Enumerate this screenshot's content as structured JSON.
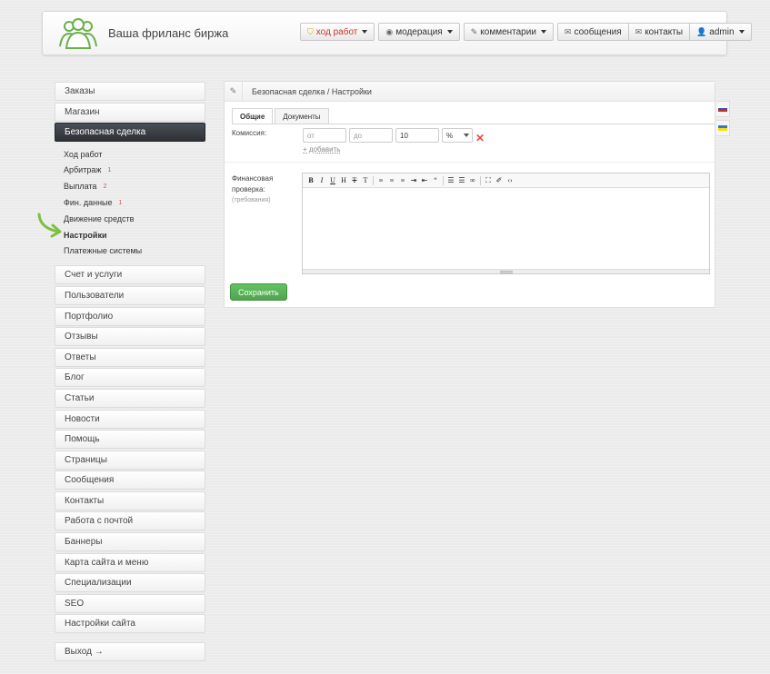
{
  "header": {
    "site_title": "Ваша фриланс биржа",
    "nav": [
      {
        "label": "ход работ",
        "icon": "shield-icon",
        "dropdown": true,
        "active": true
      },
      {
        "label": "модерация",
        "icon": "eye-icon",
        "dropdown": true
      },
      {
        "label": "комментарии",
        "icon": "pencil-icon",
        "dropdown": true
      },
      {
        "label": "сообщения",
        "icon": "envelope-icon"
      },
      {
        "label": "контакты",
        "icon": "envelope-icon"
      },
      {
        "label": "admin",
        "icon": "user-icon",
        "dropdown": true
      }
    ]
  },
  "sidebar": {
    "top_items": [
      "Заказы",
      "Магазин"
    ],
    "active_item": "Безопасная сделка",
    "subitems": [
      {
        "label": "Ход работ",
        "badge": ""
      },
      {
        "label": "Арбитраж",
        "badge": "1"
      },
      {
        "label": "Выплата",
        "badge": "2"
      },
      {
        "label": "Фин. данные",
        "badge": "1"
      },
      {
        "label": "Движение средств",
        "badge": ""
      },
      {
        "label": "Настройки",
        "badge": "",
        "current": true
      },
      {
        "label": "Платежные системы",
        "badge": ""
      }
    ],
    "items": [
      "Счет и услуги",
      "Пользователи",
      "Портфолио",
      "Отзывы",
      "Ответы",
      "Блог",
      "Статьи",
      "Новости",
      "Помощь",
      "Страницы",
      "Сообщения",
      "Контакты",
      "Работа с почтой",
      "Баннеры",
      "Карта сайта и меню",
      "Специализации",
      "SEO",
      "Настройки сайта"
    ],
    "logout": "Выход →"
  },
  "panel": {
    "breadcrumb": "Безопасная сделка / Настройки",
    "tabs": [
      "Общие",
      "Документы"
    ],
    "commission_label": "Комиссия:",
    "from_placeholder": "от",
    "to_placeholder": "до",
    "value": "10",
    "unit": "%",
    "add_link": "+ добавить",
    "fin_label_1": "Финансовая",
    "fin_label_2": "проверка:",
    "fin_hint": "(требования)",
    "save_label": "Сохранить"
  },
  "colors": {
    "accent_green": "#51a351",
    "active_menu": "#2d3136",
    "badge": "#d9534f"
  }
}
